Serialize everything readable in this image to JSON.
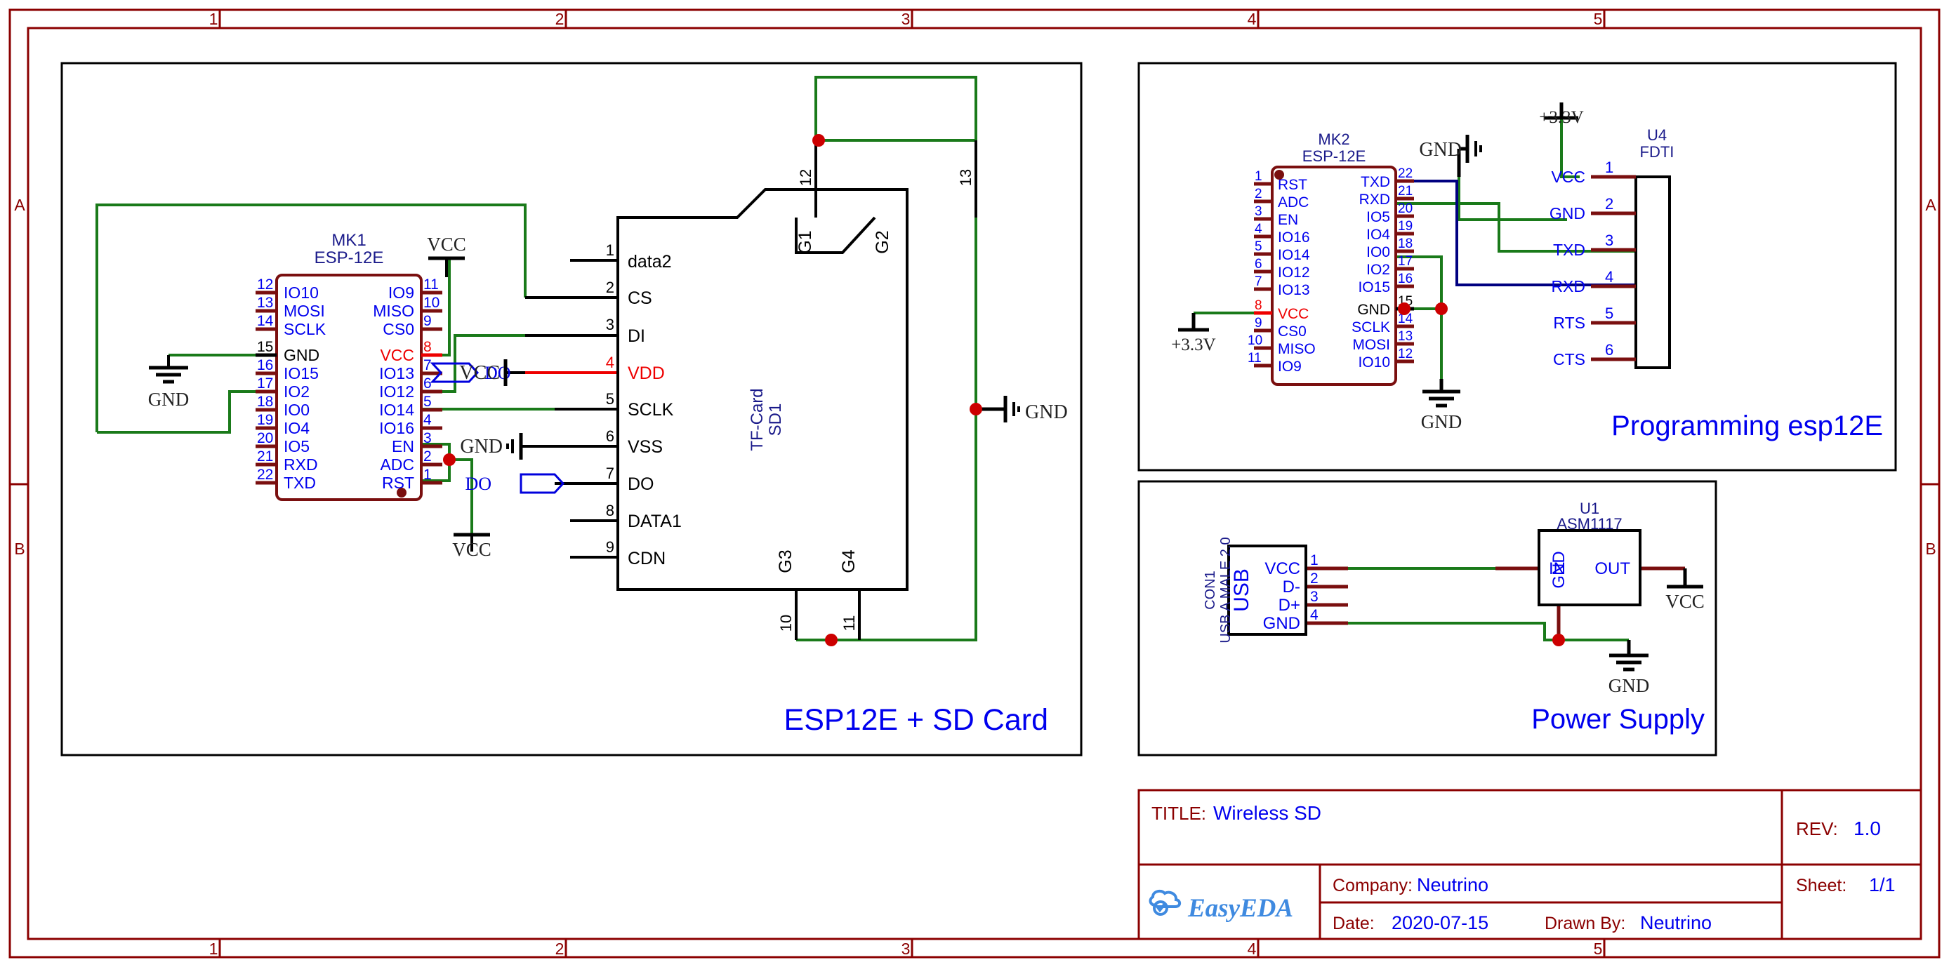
{
  "sheet": {
    "border_color": "#8b0000",
    "zone_columns": [
      "1",
      "2",
      "3",
      "4",
      "5"
    ],
    "zone_rows": [
      "A",
      "B"
    ]
  },
  "title_block": {
    "title_label": "TITLE:",
    "title_value": "Wireless SD",
    "rev_label": "REV:",
    "rev_value": "1.0",
    "company_label": "Company:",
    "company_value": "Neutrino",
    "sheet_label": "Sheet:",
    "sheet_value": "1/1",
    "date_label": "Date:",
    "date_value": "2020-07-15",
    "drawn_by_label": "Drawn By:",
    "drawn_by_value": "Neutrino",
    "logo_text": "EasyEDA",
    "label_color": "#8b0000",
    "value_color": "#0000ee"
  },
  "blocks": {
    "esp_sd": {
      "title": "ESP12E + SD Card"
    },
    "programming": {
      "title": "Programming esp12E"
    },
    "power": {
      "title": "Power Supply"
    }
  },
  "components": {
    "mk1": {
      "designator": "MK1",
      "part": "ESP-12E",
      "left_pins": [
        {
          "num": "12",
          "name": "IO10"
        },
        {
          "num": "13",
          "name": "MOSI"
        },
        {
          "num": "14",
          "name": "SCLK"
        },
        {
          "num": "15",
          "name": "GND"
        },
        {
          "num": "16",
          "name": "IO15"
        },
        {
          "num": "17",
          "name": "IO2"
        },
        {
          "num": "18",
          "name": "IO0"
        },
        {
          "num": "19",
          "name": "IO4"
        },
        {
          "num": "20",
          "name": "IO5"
        },
        {
          "num": "21",
          "name": "RXD"
        },
        {
          "num": "22",
          "name": "TXD"
        }
      ],
      "right_pins": [
        {
          "num": "11",
          "name": "IO9"
        },
        {
          "num": "10",
          "name": "MISO"
        },
        {
          "num": "9",
          "name": "CS0"
        },
        {
          "num": "8",
          "name": "VCC"
        },
        {
          "num": "7",
          "name": "IO13"
        },
        {
          "num": "6",
          "name": "IO12"
        },
        {
          "num": "5",
          "name": "IO14"
        },
        {
          "num": "4",
          "name": "IO16"
        },
        {
          "num": "3",
          "name": "EN"
        },
        {
          "num": "2",
          "name": "ADC"
        },
        {
          "num": "1",
          "name": "RST"
        }
      ]
    },
    "sd1": {
      "designator": "SD1",
      "part": "TF-Card",
      "left_pins": [
        {
          "num": "1",
          "name": "data2"
        },
        {
          "num": "2",
          "name": "CS"
        },
        {
          "num": "3",
          "name": "DI"
        },
        {
          "num": "4",
          "name": "VDD"
        },
        {
          "num": "5",
          "name": "SCLK"
        },
        {
          "num": "6",
          "name": "VSS"
        },
        {
          "num": "7",
          "name": "DO"
        },
        {
          "num": "8",
          "name": "DATA1"
        },
        {
          "num": "9",
          "name": "CDN"
        }
      ],
      "top_pins": [
        {
          "num": "12",
          "name": "G1"
        },
        {
          "num": "13",
          "name": "G2"
        }
      ],
      "bottom_pins": [
        {
          "num": "10",
          "name": "G3"
        },
        {
          "num": "11",
          "name": "G4"
        }
      ]
    },
    "mk2": {
      "designator": "MK2",
      "part": "ESP-12E",
      "left_pins": [
        {
          "num": "1",
          "name": "RST"
        },
        {
          "num": "2",
          "name": "ADC"
        },
        {
          "num": "3",
          "name": "EN"
        },
        {
          "num": "4",
          "name": "IO16"
        },
        {
          "num": "5",
          "name": "IO14"
        },
        {
          "num": "6",
          "name": "IO12"
        },
        {
          "num": "7",
          "name": "IO13"
        },
        {
          "num": "8",
          "name": "VCC"
        },
        {
          "num": "9",
          "name": "CS0"
        },
        {
          "num": "10",
          "name": "MISO"
        },
        {
          "num": "11",
          "name": "IO9"
        }
      ],
      "right_pins": [
        {
          "num": "22",
          "name": "TXD"
        },
        {
          "num": "21",
          "name": "RXD"
        },
        {
          "num": "20",
          "name": "IO5"
        },
        {
          "num": "19",
          "name": "IO4"
        },
        {
          "num": "18",
          "name": "IO0"
        },
        {
          "num": "17",
          "name": "IO2"
        },
        {
          "num": "16",
          "name": "IO15"
        },
        {
          "num": "15",
          "name": "GND"
        },
        {
          "num": "14",
          "name": "SCLK"
        },
        {
          "num": "13",
          "name": "MOSI"
        },
        {
          "num": "12",
          "name": "IO10"
        }
      ]
    },
    "u4": {
      "designator": "U4",
      "part": "FDTI",
      "pins": [
        {
          "num": "1",
          "name": "VCC"
        },
        {
          "num": "2",
          "name": "GND"
        },
        {
          "num": "3",
          "name": "TXD"
        },
        {
          "num": "4",
          "name": "RXD"
        },
        {
          "num": "5",
          "name": "RTS"
        },
        {
          "num": "6",
          "name": "CTS"
        }
      ]
    },
    "con1": {
      "designator": "CON1",
      "part": "USB A MALE 2.0",
      "body_label": "USB",
      "pins": [
        {
          "num": "1",
          "name": "VCC"
        },
        {
          "num": "2",
          "name": "D-"
        },
        {
          "num": "3",
          "name": "D+"
        },
        {
          "num": "4",
          "name": "GND"
        }
      ]
    },
    "u1": {
      "designator": "U1",
      "part": "ASM1117",
      "pins": [
        {
          "name": "IN"
        },
        {
          "name": "GND"
        },
        {
          "name": "OUT"
        }
      ]
    }
  },
  "net_symbols": {
    "vcc": "VCC",
    "gnd": "GND",
    "v33": "+3.3V",
    "do_label": "DO"
  },
  "colors": {
    "wire_green": "#1a7a1a",
    "wire_blue": "#000080",
    "wire_red": "#ee0000",
    "wire_black": "#000000",
    "pin_dark_red": "#7a0f0f",
    "label_blue": "#0000ee",
    "junction": "#cc0000",
    "net_label_blue": "#0000dd"
  }
}
